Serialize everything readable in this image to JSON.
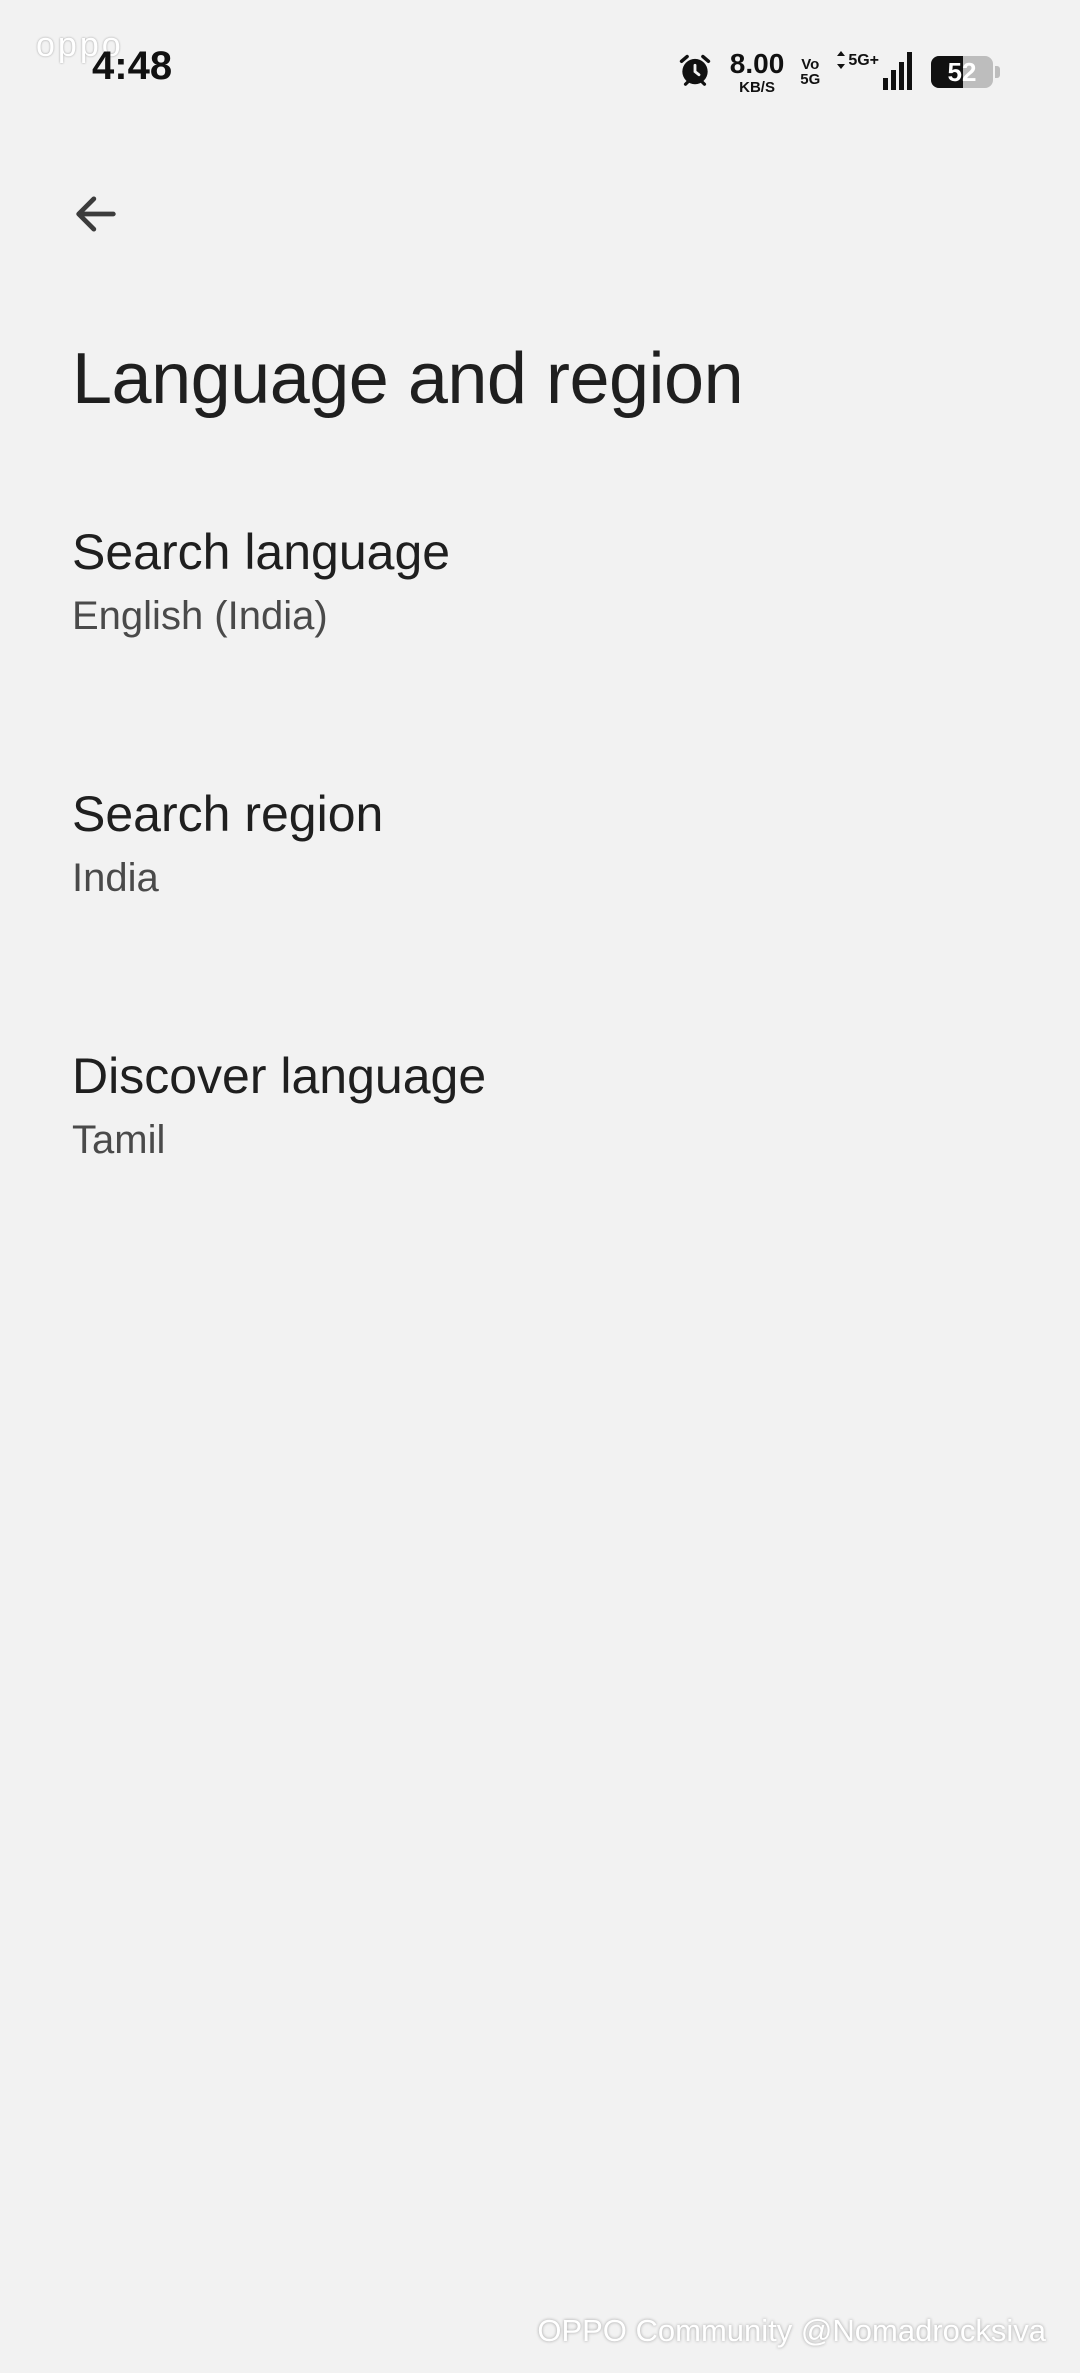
{
  "status_bar": {
    "brand": "oppo",
    "time": "4:48",
    "speed_value": "8.00",
    "speed_unit": "KB/S",
    "volte_top": "Vo",
    "volte_bottom": "5G",
    "network": "5G+",
    "battery_level": "52",
    "battery_percent": 52
  },
  "toolbar": {
    "back_icon": "arrow-left-icon"
  },
  "page": {
    "title": "Language and region"
  },
  "settings": [
    {
      "title": "Search language",
      "value": "English (India)"
    },
    {
      "title": "Search region",
      "value": "India"
    },
    {
      "title": "Discover language",
      "value": "Tamil"
    }
  ],
  "footer": {
    "watermark": "OPPO Community @Nomadrocksiva"
  },
  "colors": {
    "background": "#f2f2f2",
    "text_primary": "#1f1f1f",
    "text_secondary": "#4a4a4a"
  }
}
